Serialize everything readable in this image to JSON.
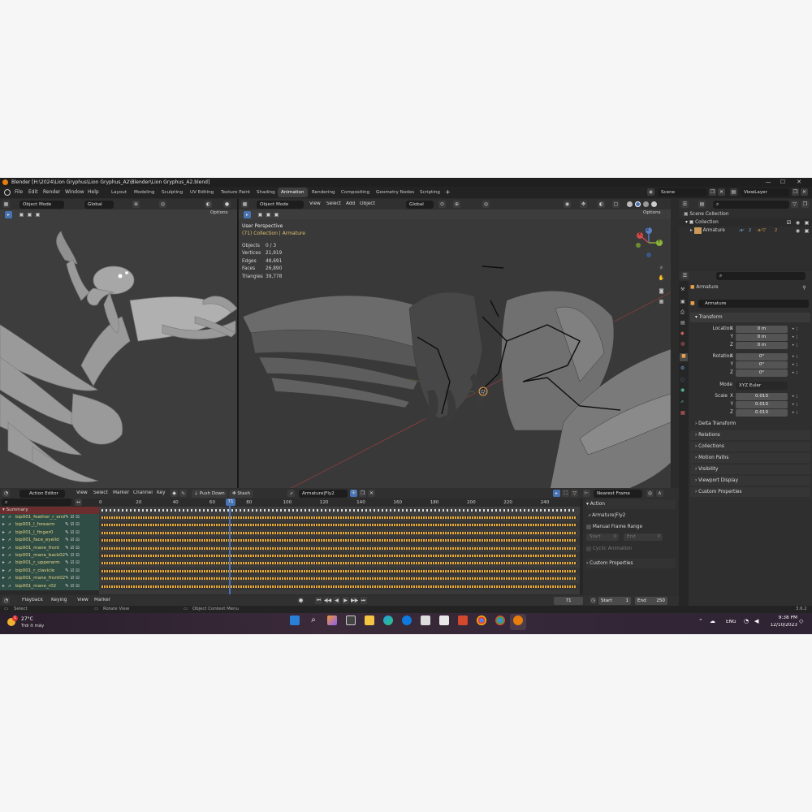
{
  "window": {
    "title": "Blender [H:\\2024\\Lion Gryphus\\Lion Gryphus_A2\\Blender\\Lion Gryphus_A2.blend]",
    "controls": [
      "—",
      "☐",
      "✕"
    ]
  },
  "menu": [
    "File",
    "Edit",
    "Render",
    "Window",
    "Help"
  ],
  "workspaces": [
    "Layout",
    "Modeling",
    "Sculpting",
    "UV Editing",
    "Texture Paint",
    "Shading",
    "Animation",
    "Rendering",
    "Compositing",
    "Geometry Nodes",
    "Scripting"
  ],
  "active_workspace": "Animation",
  "scene": {
    "name": "Scene",
    "view_layer": "ViewLayer"
  },
  "left_viewport": {
    "mode": "Object Mode",
    "orientation": "Global",
    "options_label": "Options"
  },
  "main_viewport": {
    "mode": "Object Mode",
    "menus": [
      "View",
      "Select",
      "Add",
      "Object"
    ],
    "orientation": "Global",
    "options_label": "Options",
    "title": "User Perspective",
    "subtitle": "(71) Collection | Armature",
    "stats": [
      {
        "label": "Objects",
        "value": "0 / 3"
      },
      {
        "label": "Vertices",
        "value": "21,919"
      },
      {
        "label": "Edges",
        "value": "48,691"
      },
      {
        "label": "Faces",
        "value": "26,890"
      },
      {
        "label": "Triangles",
        "value": "39,778"
      }
    ],
    "gizmo": {
      "x": "X",
      "y": "Y",
      "z": "Z"
    }
  },
  "outliner": {
    "root": "Scene Collection",
    "items": [
      {
        "label": "Collection"
      },
      {
        "label": "Armature",
        "badge1": "2",
        "badge2": "2"
      }
    ]
  },
  "properties": {
    "object_name": "Armature",
    "data_name": "Armature",
    "transform_label": "Transform",
    "location": {
      "label": "Location",
      "x": "0 m",
      "y": "0 m",
      "z": "0 m"
    },
    "rotation": {
      "label": "Rotation",
      "x": "0°",
      "y": "0°",
      "z": "0°"
    },
    "mode": {
      "label": "Mode",
      "value": "XYZ Euler"
    },
    "scale": {
      "label": "Scale",
      "x": "0.010",
      "y": "0.010",
      "z": "0.010"
    },
    "axis_labels": {
      "x": "X",
      "y": "Y",
      "z": "Z"
    },
    "sections": [
      "Delta Transform",
      "Relations",
      "Collections",
      "Motion Paths",
      "Visibility",
      "Viewport Display",
      "Custom Properties"
    ]
  },
  "action_editor": {
    "editor_label": "Action Editor",
    "menus": [
      "View",
      "Select",
      "Marker",
      "Channel",
      "Key"
    ],
    "push_down": "Push Down",
    "stash": "Stash",
    "action_name": "Armature|Fly2",
    "snap": "Nearest Frame",
    "ruler": [
      "0",
      "20",
      "40",
      "60",
      "80",
      "100",
      "120",
      "140",
      "160",
      "180",
      "200",
      "220",
      "240"
    ],
    "current_frame": "71",
    "summary": "Summary",
    "channels": [
      "bip001_feather_r_end",
      "bip001_l_forearm",
      "bip001_l_finger0",
      "bip001_face_eyelid",
      "bip001_mane_front",
      "bip001_mane_back02",
      "bip001_r_upperarm",
      "bip001_r_clavicle",
      "bip001_mane_front02",
      "bip001_mane_r02"
    ],
    "sidebar": {
      "title": "Action",
      "action": "Armature|Fly2",
      "manual_range": "Manual Frame Range",
      "start_label": "Start",
      "start_value": "0",
      "end_label": "End",
      "end_value": "0",
      "cyclic": "Cyclic Animation",
      "custom_props": "Custom Properties"
    }
  },
  "timeline": {
    "menus": [
      "Playback",
      "Keying",
      "View",
      "Marker"
    ],
    "frame": "71",
    "start_label": "Start",
    "start": "1",
    "end_label": "End",
    "end": "250"
  },
  "statusbar": {
    "select": "Select",
    "rotate": "Rotate View",
    "context": "Object Context Menu",
    "version": "3.6.2"
  },
  "taskbar": {
    "weather_temp": "27°C",
    "weather_desc": "Trời ít mây",
    "weather_badge": "1",
    "lang": "ENG",
    "time": "9:38 PM",
    "date": "12/10/2023"
  },
  "colors": {
    "accent": "#4772b3",
    "keyframe": "#e7a93a",
    "channel_bg": "#2f4d44",
    "summary_bg": "#6b2d2d"
  }
}
